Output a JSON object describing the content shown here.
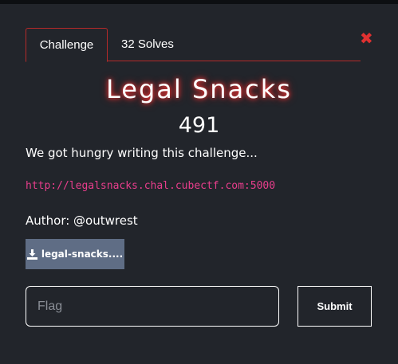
{
  "tabs": [
    {
      "label": "Challenge",
      "active": true
    },
    {
      "label": "32 Solves",
      "active": false
    }
  ],
  "close": {
    "glyph": "✖"
  },
  "challenge": {
    "name": "Legal Snacks",
    "value": "491",
    "description": "We got hungry writing this challenge...",
    "link": "http://legalsnacks.chal.cubectf.com:5000",
    "author": "Author: @outwrest"
  },
  "files": [
    {
      "label": "legal-snacks....",
      "icon": "download-icon"
    }
  ],
  "flag_form": {
    "placeholder": "Flag",
    "value": "",
    "submit_label": "Submit"
  },
  "colors": {
    "modal_bg": "#22252b",
    "page_bg": "#111317",
    "accent_red": "#b52a2a",
    "close_red": "#e03131",
    "link_pink": "#e83e8c",
    "file_button": "#5f6d85"
  }
}
